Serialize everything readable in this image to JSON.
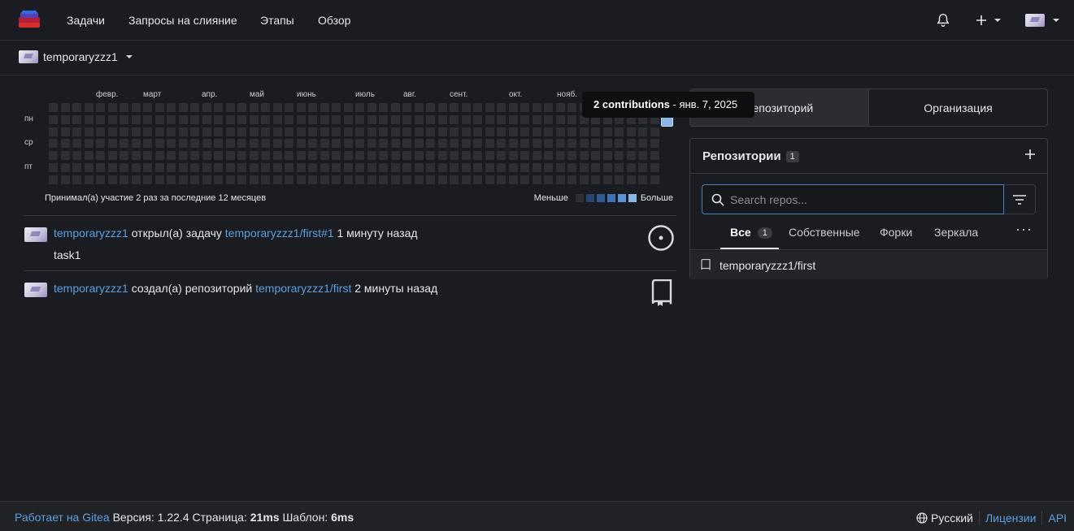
{
  "nav": {
    "items": [
      "Задачи",
      "Запросы на слияние",
      "Этапы",
      "Обзор"
    ]
  },
  "context": {
    "user": "temporaryzzz1"
  },
  "heatmap": {
    "months": [
      "февр.",
      "март",
      "апр.",
      "май",
      "июнь",
      "июль",
      "авг.",
      "сент.",
      "окт.",
      "нояб."
    ],
    "days": [
      "пн",
      "ср",
      "пт"
    ],
    "caption": "Принимал(а) участие 2 раз за последние 12 месяцев",
    "legend_less": "Меньше",
    "legend_more": "Больше",
    "legend_colors": [
      "#2d2f33",
      "#25466e",
      "#2f5b91",
      "#3d72b5",
      "#5a93d6",
      "#8bb6e8"
    ],
    "highlight_color": "#8bb6e8",
    "tooltip_bold": "2 contributions",
    "tooltip_rest": " - янв. 7, 2025"
  },
  "feed": [
    {
      "user": "temporaryzzz1",
      "action": " открыл(а) задачу ",
      "target": "temporaryzzz1/first#1",
      "time": " 1 минуту назад",
      "detail": "task1",
      "icon": "issue-opened-icon"
    },
    {
      "user": "temporaryzzz1",
      "action": " создал(а) репозиторий ",
      "target": "temporaryzzz1/first",
      "time": " 2 минуты назад",
      "icon": "repo-icon"
    }
  ],
  "panel": {
    "seg_repo": "Репозиторий",
    "seg_org": "Организация",
    "title": "Репозитории",
    "count": "1",
    "search_placeholder": "Search repos...",
    "tabs": {
      "all": "Все",
      "all_count": "1",
      "own": "Собственные",
      "forks": "Форки",
      "mirrors": "Зеркала"
    },
    "repos": [
      "temporaryzzz1/first"
    ]
  },
  "footer": {
    "powered": "Работает на Gitea",
    "version_label": " Версия: ",
    "version": "1.22.4",
    "page_label": " Страница: ",
    "page_time": "21ms",
    "tmpl_label": " Шаблон: ",
    "tmpl_time": "6ms",
    "language": "Русский",
    "licenses": "Лицензии",
    "api": "API"
  },
  "colors": {
    "accent": "#5a9fe0",
    "background": "#1b1c21"
  }
}
